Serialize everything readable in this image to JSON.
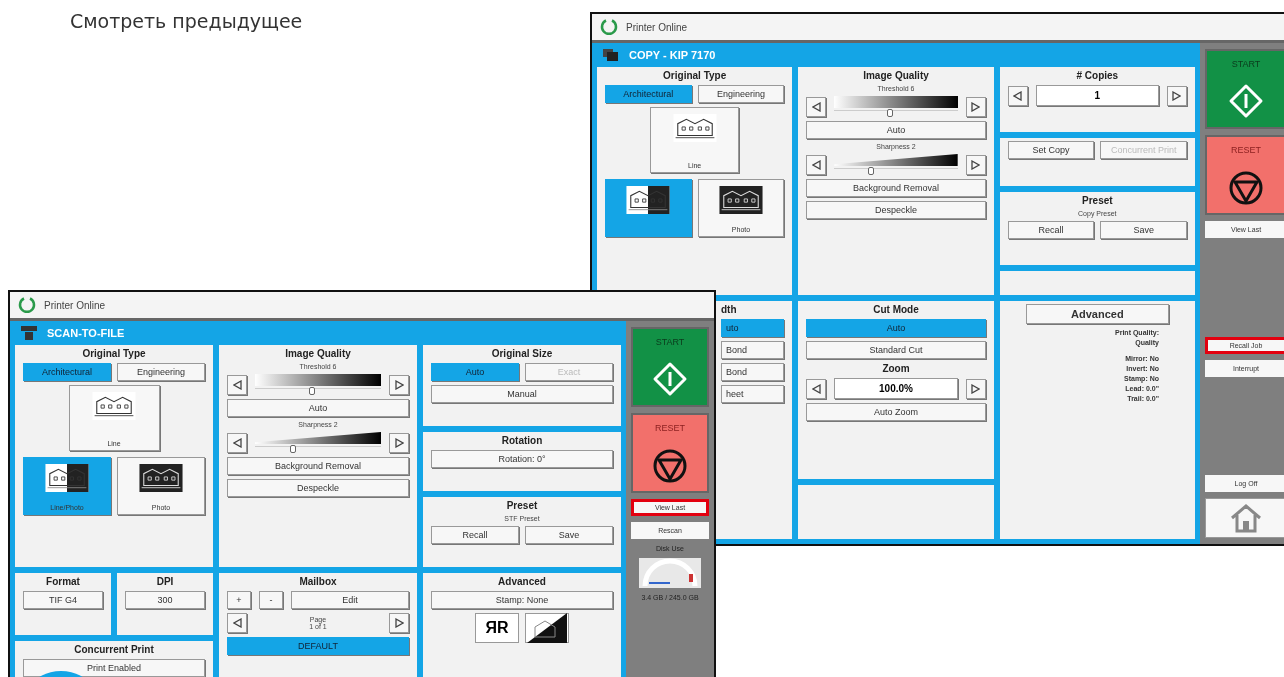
{
  "heading": "Смотреть предыдущее",
  "windows": [
    {
      "title": "Printer Online",
      "mode": {
        "kind": "copy",
        "title": "COPY - KIP 7170"
      },
      "rows": [
        [
          {
            "kind": "panel",
            "items": [
              {
                "kind": "heading",
                "text": "Original Type"
              },
              {
                "kind": "segmented",
                "options": [
                  {
                    "label": "Architectural",
                    "selected": true
                  },
                  {
                    "label": "Engineering",
                    "selected": false
                  }
                ]
              },
              {
                "kind": "tiles",
                "tiles": [
                  {
                    "kind": "line",
                    "label": "Line",
                    "selected": false
                  },
                  {
                    "kind": "linephoto",
                    "selected": true
                  },
                  {
                    "kind": "photo",
                    "label": "Photo",
                    "selected": false
                  }
                ]
              }
            ]
          },
          {
            "kind": "panel",
            "items": [
              {
                "kind": "heading",
                "text": "Image Quality"
              },
              {
                "kind": "fade-slider",
                "caption": "Threshold 6",
                "level": 0.45
              },
              {
                "kind": "button",
                "label": "Auto"
              },
              {
                "kind": "wedge-slider",
                "caption": "Sharpness 2",
                "level": 0.3
              },
              {
                "kind": "button",
                "label": "Background Removal"
              },
              {
                "kind": "button",
                "label": "Despeckle"
              }
            ]
          },
          {
            "kind": "stack",
            "cells": [
              {
                "kind": "panel",
                "items": [
                  {
                    "kind": "heading",
                    "text": "# Copies"
                  },
                  {
                    "kind": "stepper",
                    "value": "1"
                  }
                ]
              },
              {
                "kind": "panel",
                "items": [
                  {
                    "kind": "segmented",
                    "options": [
                      {
                        "label": "Set Copy",
                        "disabled": false
                      },
                      {
                        "label": "Concurrent Print",
                        "disabled": true
                      }
                    ]
                  }
                ]
              },
              {
                "kind": "panel",
                "items": [
                  {
                    "kind": "heading",
                    "text": "Preset"
                  },
                  {
                    "kind": "caption",
                    "text": "Copy Preset"
                  },
                  {
                    "kind": "segmented",
                    "options": [
                      {
                        "label": "Recall"
                      },
                      {
                        "label": "Save"
                      }
                    ]
                  }
                ]
              },
              {
                "kind": "blank"
              }
            ]
          }
        ],
        [
          {
            "kind": "partial",
            "items": [
              {
                "kind": "heading",
                "text": "dth"
              },
              {
                "kind": "button",
                "label": "uto",
                "selected": true
              },
              {
                "kind": "button",
                "label": "Bond",
                "selected": false
              },
              {
                "kind": "button",
                "label": "Bond",
                "selected": false
              },
              {
                "kind": "button",
                "label": "heet",
                "selected": false
              }
            ]
          },
          {
            "kind": "stack",
            "cells": [
              {
                "kind": "panel",
                "items": [
                  {
                    "kind": "heading",
                    "text": "Cut Mode"
                  },
                  {
                    "kind": "button",
                    "label": "Auto",
                    "selected": true
                  },
                  {
                    "kind": "button",
                    "label": "Standard Cut",
                    "selected": false
                  },
                  {
                    "kind": "heading",
                    "text": "Zoom"
                  },
                  {
                    "kind": "stepper",
                    "value": "100.0%"
                  },
                  {
                    "kind": "button",
                    "label": "Auto Zoom"
                  }
                ]
              },
              {
                "kind": "blank"
              }
            ]
          },
          {
            "kind": "panel",
            "items": [
              {
                "kind": "title-button",
                "label": "Advanced"
              },
              {
                "kind": "info",
                "lines": [
                  "Print Quality:",
                  "Quality",
                  "Mirror: No",
                  "Invert: No",
                  "Stamp: No",
                  "Lead: 0.0\"",
                  "Trail: 0.0\""
                ]
              }
            ]
          }
        ]
      ],
      "side": [
        {
          "kind": "start",
          "label": "START"
        },
        {
          "kind": "reset",
          "label": "RESET"
        },
        {
          "kind": "button",
          "label": "View Last",
          "highlighted": false
        },
        {
          "kind": "spacer"
        },
        {
          "kind": "button",
          "label": "Recall Job",
          "highlighted": true
        },
        {
          "kind": "button",
          "label": "Interrupt",
          "highlighted": false
        },
        {
          "kind": "spacer"
        },
        {
          "kind": "button",
          "label": "Log Off",
          "highlighted": false
        },
        {
          "kind": "home"
        }
      ]
    },
    {
      "title": "Printer Online",
      "mode": {
        "kind": "scan",
        "title": "SCAN-TO-FILE"
      },
      "rows": [
        [
          {
            "kind": "panel",
            "items": [
              {
                "kind": "heading",
                "text": "Original Type"
              },
              {
                "kind": "segmented",
                "options": [
                  {
                    "label": "Architectural",
                    "selected": true
                  },
                  {
                    "label": "Engineering",
                    "selected": false
                  }
                ]
              },
              {
                "kind": "tiles",
                "tiles": [
                  {
                    "kind": "line",
                    "label": "Line",
                    "selected": false
                  },
                  {
                    "kind": "linephoto",
                    "label": "Line/Photo",
                    "selected": true
                  },
                  {
                    "kind": "photo",
                    "label": "Photo",
                    "selected": false
                  }
                ]
              }
            ]
          },
          {
            "kind": "panel",
            "items": [
              {
                "kind": "heading",
                "text": "Image Quality"
              },
              {
                "kind": "fade-slider",
                "caption": "Threshold 6",
                "level": 0.45
              },
              {
                "kind": "button",
                "label": "Auto"
              },
              {
                "kind": "wedge-slider",
                "caption": "Sharpness 2",
                "level": 0.3
              },
              {
                "kind": "button",
                "label": "Background Removal"
              },
              {
                "kind": "button",
                "label": "Despeckle"
              }
            ]
          },
          {
            "kind": "stack",
            "cells": [
              {
                "kind": "panel",
                "items": [
                  {
                    "kind": "heading",
                    "text": "Original Size"
                  },
                  {
                    "kind": "segmented",
                    "options": [
                      {
                        "label": "Auto",
                        "selected": true,
                        "disabled": false
                      },
                      {
                        "label": "Exact",
                        "selected": false,
                        "disabled": true
                      }
                    ]
                  },
                  {
                    "kind": "button",
                    "label": "Manual"
                  }
                ]
              },
              {
                "kind": "panel",
                "items": [
                  {
                    "kind": "heading",
                    "text": "Rotation"
                  },
                  {
                    "kind": "button",
                    "label": "Rotation: 0°"
                  }
                ]
              },
              {
                "kind": "panel",
                "items": [
                  {
                    "kind": "heading",
                    "text": "Preset"
                  },
                  {
                    "kind": "caption",
                    "text": "STF Preset"
                  },
                  {
                    "kind": "segmented",
                    "options": [
                      {
                        "label": "Recall"
                      },
                      {
                        "label": "Save"
                      }
                    ]
                  }
                ]
              }
            ]
          }
        ],
        [
          {
            "kind": "stack",
            "cells": [
              {
                "kind": "split",
                "cells": [
                  {
                    "kind": "panel",
                    "items": [
                      {
                        "kind": "heading",
                        "text": "Format"
                      },
                      {
                        "kind": "button",
                        "label": "TIF G4"
                      }
                    ]
                  },
                  {
                    "kind": "panel",
                    "items": [
                      {
                        "kind": "heading",
                        "text": "DPI"
                      },
                      {
                        "kind": "button",
                        "label": "300"
                      }
                    ]
                  }
                ]
              },
              {
                "kind": "panel",
                "items": [
                  {
                    "kind": "heading",
                    "text": "Concurrent Print"
                  },
                  {
                    "kind": "button",
                    "label": "Print Enabled"
                  }
                ]
              }
            ]
          },
          {
            "kind": "panel",
            "items": [
              {
                "kind": "heading",
                "text": "Mailbox"
              },
              {
                "kind": "mailbox",
                "add": "+",
                "remove": "-",
                "edit": "Edit"
              },
              {
                "kind": "pager",
                "label": "Page",
                "pages": "1 of 1"
              },
              {
                "kind": "button",
                "label": "DEFAULT",
                "selected": true
              }
            ]
          },
          {
            "kind": "panel",
            "items": [
              {
                "kind": "heading",
                "text": "Advanced"
              },
              {
                "kind": "button",
                "label": "Stamp: None"
              },
              {
                "kind": "stamp-icons",
                "mirror": "ЯR"
              }
            ]
          }
        ]
      ],
      "side": [
        {
          "kind": "start",
          "label": "START"
        },
        {
          "kind": "reset",
          "label": "RESET"
        },
        {
          "kind": "button",
          "label": "View Last",
          "highlighted": true
        },
        {
          "kind": "button",
          "label": "Rescan",
          "highlighted": false
        },
        {
          "kind": "caption",
          "text": "Disk Use"
        },
        {
          "kind": "gauge"
        },
        {
          "kind": "caption",
          "text": "3.4 GB / 245.0 GB"
        }
      ]
    }
  ]
}
